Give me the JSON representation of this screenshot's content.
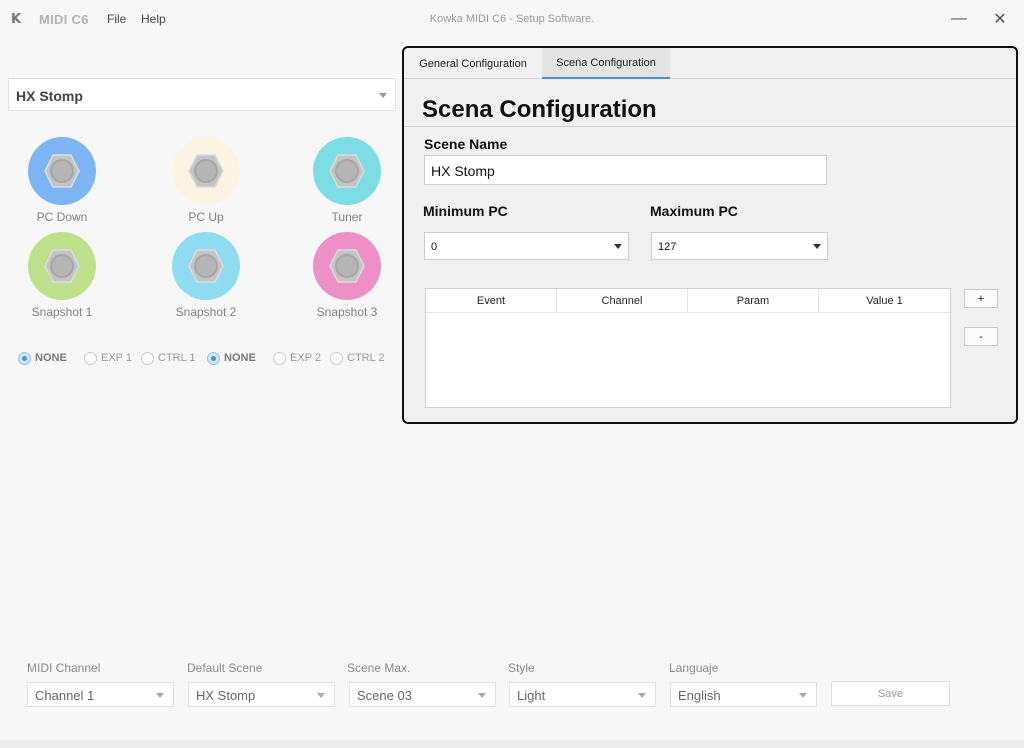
{
  "app": {
    "logo": "K",
    "name": "MIDI C6",
    "window_title": "Kowka MIDI C6 - Setup Software.",
    "menu": [
      "File",
      "Help"
    ],
    "minimize": "—",
    "close": "✕"
  },
  "scene_select": {
    "value": "HX Stomp"
  },
  "pedals": [
    {
      "label": "PC Down",
      "color": "#7cb5f4"
    },
    {
      "label": "PC Up",
      "color": "#fdf3e3"
    },
    {
      "label": "Tuner",
      "color": "#7ddde4"
    },
    {
      "label": "Snapshot 1",
      "color": "#bde18a"
    },
    {
      "label": "Snapshot 2",
      "color": "#8fdcf0"
    },
    {
      "label": "Snapshot 3",
      "color": "#ee8fc7"
    }
  ],
  "radios": [
    {
      "label": "NONE",
      "selected": true
    },
    {
      "label": "EXP 1",
      "selected": false
    },
    {
      "label": "CTRL 1",
      "selected": false
    },
    {
      "label": "NONE",
      "selected": true
    },
    {
      "label": "EXP 2",
      "selected": false
    },
    {
      "label": "CTRL 2",
      "selected": false
    }
  ],
  "panel": {
    "tabs": [
      "General Configuration",
      "Scena Configuration"
    ],
    "active_tab": "Scena Configuration",
    "title": "Scena Configuration",
    "scene_name_label": "Scene Name",
    "scene_name_value": "HX Stomp",
    "min_pc_label": "Minimum PC",
    "min_pc_value": "0",
    "max_pc_label": "Maximum PC",
    "max_pc_value": "127",
    "table_columns": [
      "Event",
      "Channel",
      "Param",
      "Value 1"
    ],
    "add_label": "+",
    "remove_label": "-"
  },
  "bottom": {
    "midi_channel_label": "MIDI Channel",
    "midi_channel_value": "Channel 1",
    "default_scene_label": "Default Scene",
    "default_scene_value": "HX Stomp",
    "scene_max_label": "Scene Max.",
    "scene_max_value": "Scene 03",
    "style_label": "Style",
    "style_value": "Light",
    "language_label": "Languaje",
    "language_value": "English",
    "save_label": "Save"
  },
  "colors": {
    "accent": "#4a90d9",
    "panel_border": "#111111"
  }
}
